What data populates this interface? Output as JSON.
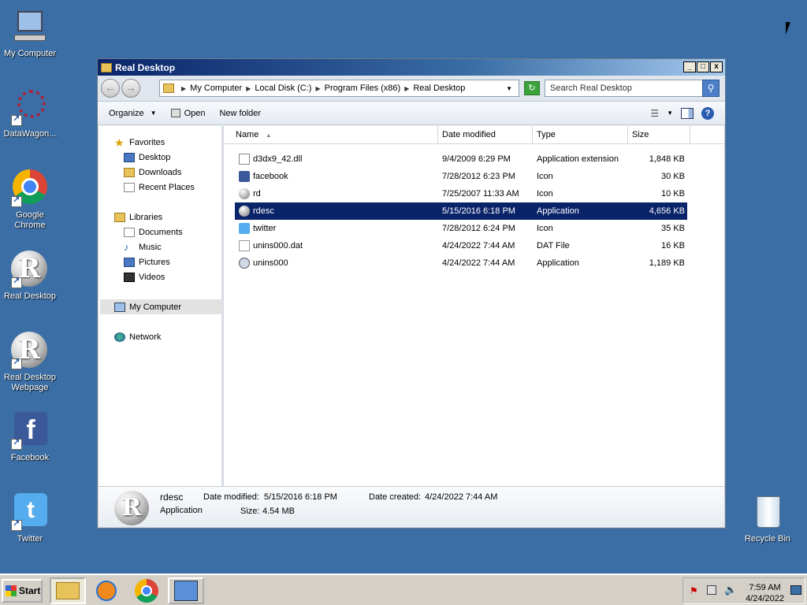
{
  "desktop": {
    "icons": [
      {
        "label": "My Computer"
      },
      {
        "label": "DataWagon..."
      },
      {
        "label": "Google Chrome"
      },
      {
        "label": "Real Desktop"
      },
      {
        "label": "Real Desktop Webpage"
      },
      {
        "label": "Facebook"
      },
      {
        "label": "Twitter"
      },
      {
        "label": "Recycle Bin"
      }
    ]
  },
  "window": {
    "title": "Real Desktop",
    "controls": {
      "minimize": "_",
      "maximize": "□",
      "close": "x"
    },
    "breadcrumb": [
      "My Computer",
      "Local Disk (C:)",
      "Program Files (x86)",
      "Real Desktop"
    ],
    "search_placeholder": "Search Real Desktop",
    "toolbar": {
      "organize": "Organize",
      "open": "Open",
      "new_folder": "New folder"
    },
    "nav": {
      "favorites": "Favorites",
      "desktop": "Desktop",
      "downloads": "Downloads",
      "recent": "Recent Places",
      "libraries": "Libraries",
      "documents": "Documents",
      "music": "Music",
      "pictures": "Pictures",
      "videos": "Videos",
      "computer": "My Computer",
      "network": "Network"
    },
    "columns": {
      "name": "Name",
      "date": "Date modified",
      "type": "Type",
      "size": "Size"
    },
    "files": [
      {
        "name": "d3dx9_42.dll",
        "date": "9/4/2009 6:29 PM",
        "type": "Application extension",
        "size": "1,848 KB",
        "icon": "dll-icon"
      },
      {
        "name": "facebook",
        "date": "7/28/2012 6:23 PM",
        "type": "Icon",
        "size": "30 KB",
        "icon": "facebook-icon"
      },
      {
        "name": "rd",
        "date": "7/25/2007 11:33 AM",
        "type": "Icon",
        "size": "10 KB",
        "icon": "r-icon"
      },
      {
        "name": "rdesc",
        "date": "5/15/2016 6:18 PM",
        "type": "Application",
        "size": "4,656 KB",
        "icon": "r-icon"
      },
      {
        "name": "twitter",
        "date": "7/28/2012 6:24 PM",
        "type": "Icon",
        "size": "35 KB",
        "icon": "twitter-icon"
      },
      {
        "name": "unins000.dat",
        "date": "4/24/2022 7:44 AM",
        "type": "DAT File",
        "size": "16 KB",
        "icon": "file-icon"
      },
      {
        "name": "unins000",
        "date": "4/24/2022 7:44 AM",
        "type": "Application",
        "size": "1,189 KB",
        "icon": "uninstall-icon"
      }
    ],
    "details": {
      "name": "rdesc",
      "type": "Application",
      "modified_label": "Date modified:",
      "modified": "5/15/2016 6:18 PM",
      "created_label": "Date created:",
      "created": "4/24/2022 7:44 AM",
      "size_label": "Size:",
      "size": "4.54 MB"
    }
  },
  "taskbar": {
    "start": "Start",
    "time": "7:59 AM",
    "date": "4/24/2022"
  }
}
